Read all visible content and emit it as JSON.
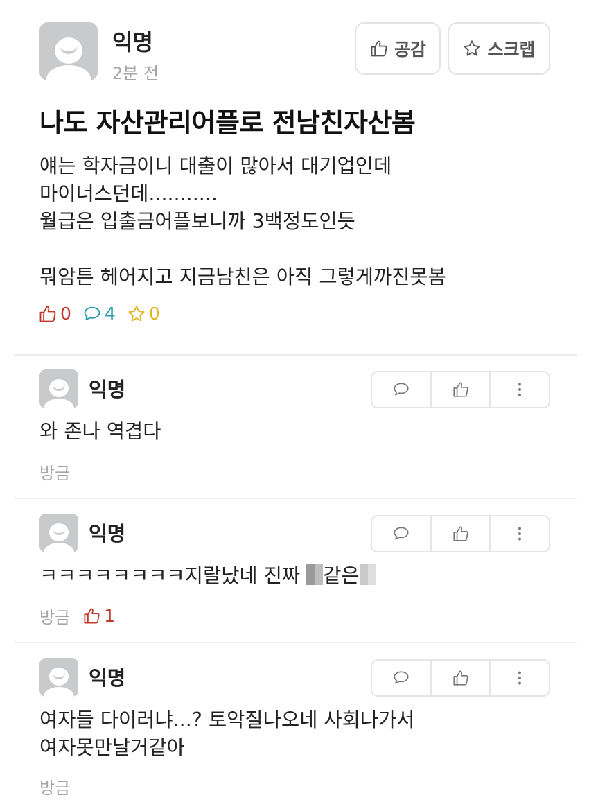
{
  "post": {
    "author": "익명",
    "time": "2분 전",
    "like_button_label": "공감",
    "scrap_button_label": "스크랩",
    "title": "나도 자산관리어플로 전남친자산봄",
    "body_lines": [
      "얘는 학자금이니 대출이 많아서 대기업인데",
      "마이너스던데...........",
      "월급은 입출금어플보니까 3백정도인듯",
      "",
      "뭐암튼 헤어지고 지금남친은 아직 그렇게까진못봄"
    ],
    "stats": {
      "likes": "0",
      "comments": "4",
      "scraps": "0"
    }
  },
  "comments": [
    {
      "author": "익명",
      "text_lines": [
        "와 존나 역겹다"
      ],
      "time": "방금",
      "likes": ""
    },
    {
      "author": "익명",
      "text_before_censor": "ㅋㅋㅋㅋㅋㅋㅋㅋ지랄났네 진짜 ",
      "text_middle": "같은",
      "time": "방금",
      "likes": "1"
    },
    {
      "author": "익명",
      "text_lines": [
        "여자들 다이러냐...? 토악질나오네 사회나가서",
        "여자못만날거같아"
      ],
      "time": "방금",
      "likes": ""
    }
  ],
  "colors": {
    "like": "#c0392b",
    "comment": "#2a9ab0",
    "scrap": "#e0b526",
    "muted": "#a6a6a6"
  },
  "icons": {
    "like": "thumbs-up-icon",
    "scrap": "star-icon",
    "comment": "speech-bubble-icon",
    "more": "more-vertical-icon"
  }
}
